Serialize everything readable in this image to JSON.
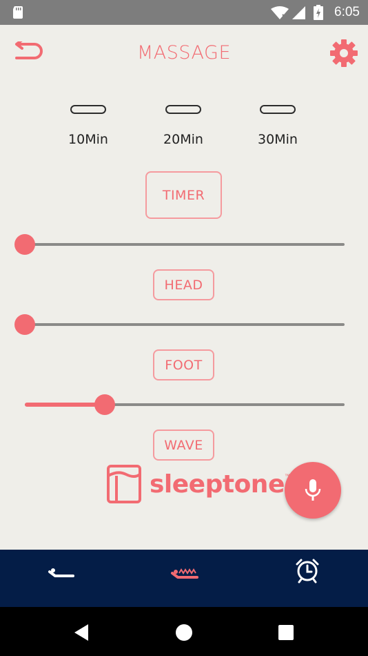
{
  "status_bar": {
    "time": "6:05",
    "icons": [
      "sd-card-icon",
      "wifi-icon",
      "signal-icon",
      "battery-charging-icon"
    ]
  },
  "header": {
    "title": "MASSAGE",
    "back_icon": "back-arrow-icon",
    "settings_icon": "gear-icon"
  },
  "timer_options": [
    {
      "label": "10Min"
    },
    {
      "label": "20Min"
    },
    {
      "label": "30Min"
    }
  ],
  "buttons": {
    "timer": "TIMER",
    "head": "HEAD",
    "foot": "FOOT",
    "wave": "WAVE"
  },
  "sliders": {
    "head_level": 0,
    "foot_level": 0,
    "wave_level": 0.25
  },
  "brand": {
    "name": "sleeptone",
    "trademark": "™"
  },
  "tabs": [
    {
      "icon": "bed-flat-icon",
      "active": false
    },
    {
      "icon": "massage-bed-icon",
      "active": true
    },
    {
      "icon": "alarm-clock-icon",
      "active": false
    }
  ],
  "colors": {
    "accent": "#f26b72",
    "tabbar": "#041d47",
    "background": "#efeee9"
  }
}
